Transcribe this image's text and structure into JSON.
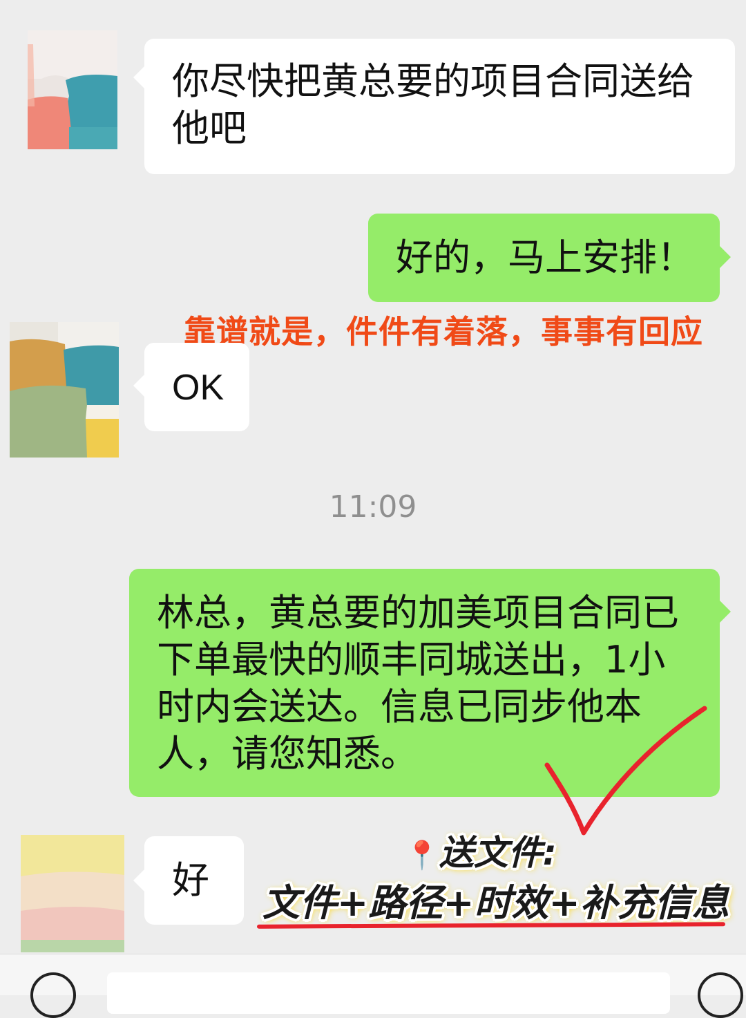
{
  "messages": [
    {
      "side": "in",
      "text": "你尽快把黄总要的项目合同送给他吧"
    },
    {
      "side": "out",
      "text": "好的，马上安排！"
    },
    {
      "side": "in",
      "text": "OK"
    },
    {
      "side": "out",
      "text": "林总，黄总要的加美项目合同已下单最快的顺丰同城送出，1小时内会送达。信息已同步他本人，请您知悉。"
    },
    {
      "side": "in",
      "text": "好"
    }
  ],
  "timestamp": "11:09",
  "annotations": {
    "red_note": "靠谱就是，件件有着落，事事有回应",
    "tip_pin": "📍",
    "tip_title": "送文件:",
    "tip_formula": "文件+路径+时效+补充信息"
  },
  "colors": {
    "background": "#ededed",
    "incoming_bubble": "#ffffff",
    "outgoing_bubble": "#95ec69",
    "red_note": "#f04a17",
    "check_mark": "#e8232d",
    "underline": "#e8232d"
  }
}
